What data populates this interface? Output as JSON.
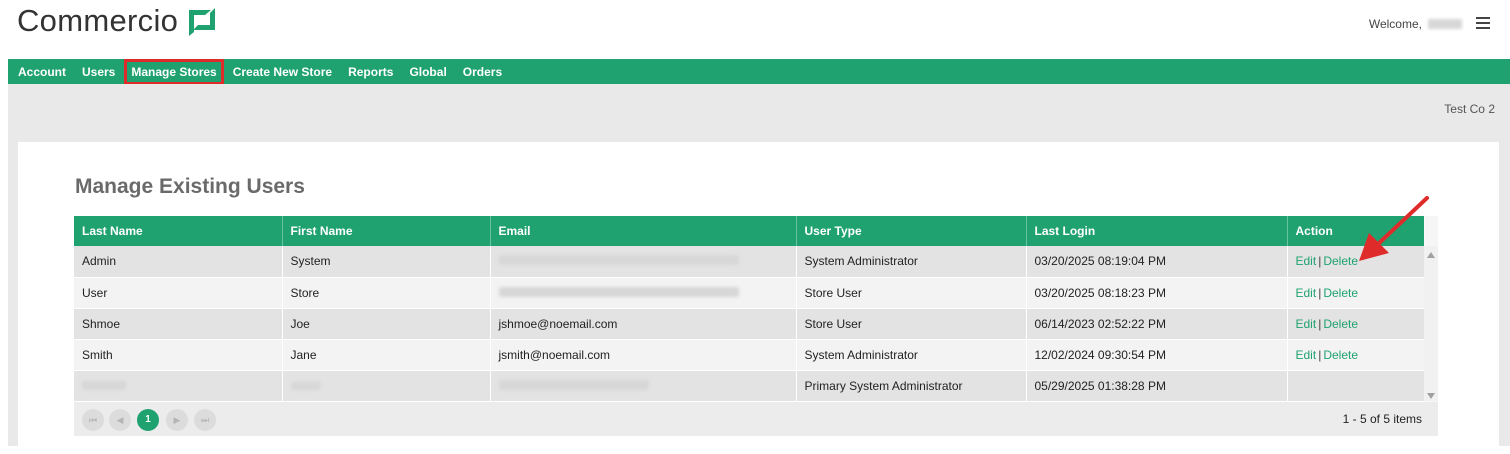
{
  "brand": {
    "name": "Commercio",
    "accent": "#1fa270",
    "highlight": "#e02b2b"
  },
  "header": {
    "welcome": "Welcome,"
  },
  "nav": {
    "items": [
      {
        "label": "Account"
      },
      {
        "label": "Users"
      },
      {
        "label": "Manage Stores"
      },
      {
        "label": "Create New Store"
      },
      {
        "label": "Reports"
      },
      {
        "label": "Global"
      },
      {
        "label": "Orders"
      }
    ]
  },
  "company": "Test Co 2",
  "page": {
    "title": "Manage Existing Users"
  },
  "table": {
    "columns": [
      "Last Name",
      "First Name",
      "Email",
      "User Type",
      "Last Login",
      "Action"
    ],
    "rows": [
      {
        "last": "Admin",
        "first": "System",
        "email": "",
        "type": "System Administrator",
        "login": "03/20/2025 08:19:04 PM",
        "edit": "Edit",
        "sep": "|",
        "delete": "Delete"
      },
      {
        "last": "User",
        "first": "Store",
        "email": "",
        "type": "Store User",
        "login": "03/20/2025 08:18:23 PM",
        "edit": "Edit",
        "sep": "|",
        "delete": "Delete"
      },
      {
        "last": "Shmoe",
        "first": "Joe",
        "email": "jshmoe@noemail.com",
        "type": "Store User",
        "login": "06/14/2023 02:52:22 PM",
        "edit": "Edit",
        "sep": "|",
        "delete": "Delete"
      },
      {
        "last": "Smith",
        "first": "Jane",
        "email": "jsmith@noemail.com",
        "type": "System Administrator",
        "login": "12/02/2024 09:30:54 PM",
        "edit": "Edit",
        "sep": "|",
        "delete": "Delete"
      },
      {
        "last": "",
        "first": "",
        "email": "",
        "type": "Primary System Administrator",
        "login": "05/29/2025 01:38:28 PM",
        "edit": "",
        "sep": "",
        "delete": ""
      }
    ]
  },
  "pager": {
    "first": "⏮",
    "prev": "◀",
    "current": "1",
    "next": "▶",
    "last": "⏭",
    "info": "1 - 5 of 5 items"
  }
}
